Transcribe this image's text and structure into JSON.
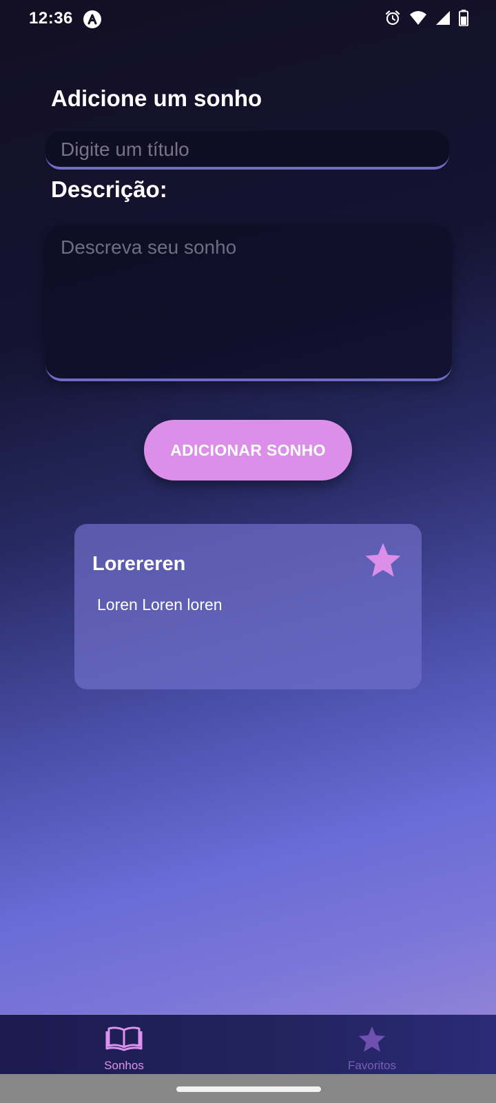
{
  "status_bar": {
    "time": "12:36",
    "icons": [
      "react-native-app-icon",
      "alarm-icon",
      "wifi-icon",
      "signal-icon",
      "battery-icon"
    ]
  },
  "form": {
    "heading": "Adicione um sonho",
    "title_placeholder": "Digite um título",
    "title_value": "",
    "description_label": "Descrição:",
    "description_placeholder": "Descreva seu sonho",
    "description_value": "",
    "submit_label": "ADICIONAR SONHO"
  },
  "dreams": [
    {
      "title": "Lorereren",
      "description": "Loren Loren loren",
      "favorite_icon": "star-icon"
    }
  ],
  "bottom_nav": {
    "tabs": [
      {
        "label": "Sonhos",
        "icon": "book-open-icon",
        "active": true
      },
      {
        "label": "Favoritos",
        "icon": "star-icon",
        "active": false
      }
    ]
  },
  "colors": {
    "accent": "#db8fe8",
    "input_underline": "#6f6fc8",
    "card_background": "#6e6ec8",
    "inactive_tab": "#7a5fb8"
  }
}
